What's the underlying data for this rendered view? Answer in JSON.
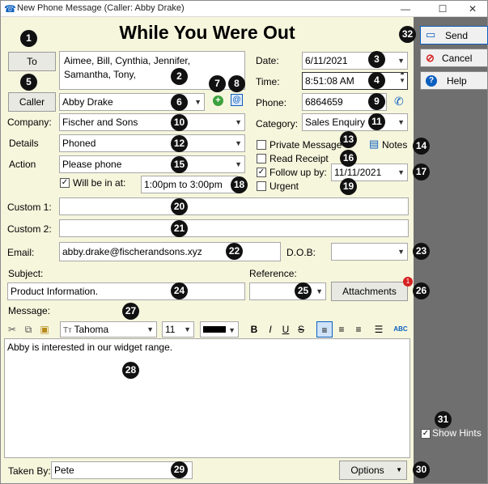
{
  "window": {
    "title": "New Phone Message (Caller: Abby Drake)",
    "minimize": "—",
    "maximize": "☐",
    "close": "✕"
  },
  "heading": "While You Were Out",
  "to": {
    "button": "To",
    "recipients_line1": "Aimee, Bill, Cynthia, Jennifer,",
    "recipients_line2": "Samantha, Tony,"
  },
  "caller": {
    "button": "Caller",
    "value": "Abby Drake"
  },
  "company": {
    "label": "Company:",
    "value": "Fischer and Sons"
  },
  "details": {
    "label": "Details",
    "value": "Phoned"
  },
  "action": {
    "label": "Action",
    "value": "Please phone"
  },
  "will_be_in": {
    "label": "Will be in at:",
    "checked": true,
    "value": "1:00pm to 3:00pm"
  },
  "custom1": {
    "label": "Custom 1:",
    "value": ""
  },
  "custom2": {
    "label": "Custom 2:",
    "value": ""
  },
  "email": {
    "label": "Email:",
    "value": "abby.drake@fischerandsons.xyz"
  },
  "dob": {
    "label": "D.O.B:",
    "value": ""
  },
  "date": {
    "label": "Date:",
    "value": "6/11/2021"
  },
  "time": {
    "label": "Time:",
    "value": "8:51:08 AM"
  },
  "phone": {
    "label": "Phone:",
    "value": "6864659"
  },
  "category": {
    "label": "Category:",
    "value": "Sales Enquiry"
  },
  "private_message": {
    "label": "Private Message",
    "checked": false
  },
  "notes": {
    "label": "Notes"
  },
  "read_receipt": {
    "label": "Read Receipt",
    "checked": false
  },
  "follow_up": {
    "label": "Follow up by:",
    "checked": true,
    "value": "11/11/2021"
  },
  "urgent": {
    "label": "Urgent",
    "checked": false
  },
  "subject": {
    "label": "Subject:",
    "value": "Product Information."
  },
  "reference": {
    "label": "Reference:",
    "value": ""
  },
  "attachments": {
    "label": "Attachments",
    "badge": "1"
  },
  "message": {
    "label": "Message:",
    "body": "Abby is interested in our widget range."
  },
  "editor_toolbar": {
    "font": "Tahoma",
    "size": "11",
    "bold": "B",
    "italic": "I",
    "underline": "U",
    "strike": "S",
    "spell": "ABC"
  },
  "taken_by": {
    "label": "Taken By:",
    "value": "Pete"
  },
  "options": {
    "label": "Options"
  },
  "side": {
    "send": "Send",
    "cancel": "Cancel",
    "help": "Help",
    "show_hints": "Show Hints",
    "show_hints_checked": true
  },
  "hints": [
    "1",
    "2",
    "3",
    "4",
    "5",
    "6",
    "7",
    "8",
    "9",
    "10",
    "11",
    "12",
    "13",
    "14",
    "15",
    "16",
    "17",
    "18",
    "19",
    "20",
    "21",
    "22",
    "23",
    "24",
    "25",
    "26",
    "27",
    "28",
    "29",
    "30",
    "31",
    "32"
  ],
  "colors": {
    "form_bg": "#f6f6dd",
    "side_bg": "#6f6f6f",
    "accent": "#0b5fbf",
    "red": "#d62020",
    "green": "#3ba03b"
  }
}
